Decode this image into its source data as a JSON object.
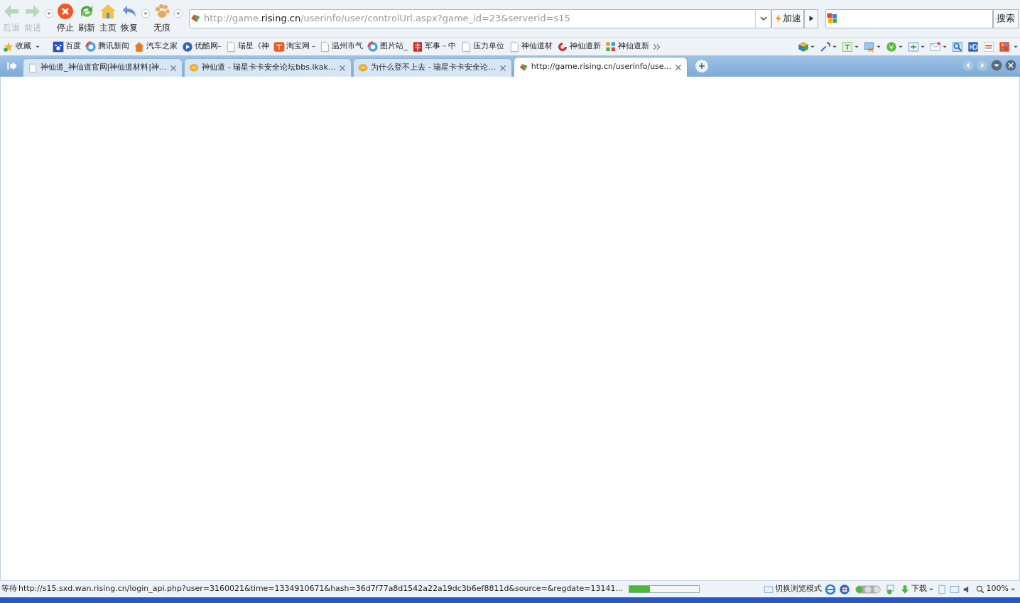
{
  "toolbar": {
    "buttons": [
      {
        "kind": "back",
        "label": "后退",
        "disabled": true
      },
      {
        "kind": "forward",
        "label": "前进",
        "disabled": true
      },
      {
        "kind": "stop",
        "label": "停止",
        "disabled": false
      },
      {
        "kind": "refresh",
        "label": "刷新",
        "disabled": false
      },
      {
        "kind": "home",
        "label": "主页",
        "disabled": false
      },
      {
        "kind": "restore",
        "label": "恢复",
        "disabled": false
      },
      {
        "kind": "private",
        "label": "无痕",
        "disabled": false
      }
    ]
  },
  "address_bar": {
    "host": "http://game.",
    "domain": "rising.cn",
    "path": "/userinfo/user/controlUrl.aspx?game_id=23&serverid=s15",
    "accelerate": "加速"
  },
  "search": {
    "button": "搜索"
  },
  "bookmarks": [
    {
      "kind": "favorites",
      "label": "收藏"
    },
    {
      "kind": "paw",
      "label": "百度"
    },
    {
      "kind": "globe",
      "label": "腾讯新闻"
    },
    {
      "kind": "home",
      "label": "汽车之家"
    },
    {
      "kind": "play",
      "label": "优酷网-"
    },
    {
      "kind": "page",
      "label": "瑞星《神"
    },
    {
      "kind": "shop",
      "label": "淘宝网 -"
    },
    {
      "kind": "page",
      "label": "温州市气"
    },
    {
      "kind": "globe",
      "label": "图片站_"
    },
    {
      "kind": "flag",
      "label": "军事－中"
    },
    {
      "kind": "page",
      "label": "压力单位"
    },
    {
      "kind": "page",
      "label": "神仙道材"
    },
    {
      "kind": "swirl",
      "label": "神仙道新"
    },
    {
      "kind": "grid",
      "label": "神仙道新"
    }
  ],
  "tabs": [
    {
      "kind": "page",
      "title": "神仙道_神仙道官网|神仙道材料|神...",
      "selected": false
    },
    {
      "kind": "chat",
      "title": "神仙道 - 瑞星卡卡安全论坛bbs.ikak...",
      "selected": false
    },
    {
      "kind": "chat",
      "title": "为什么登不上去 - 瑞星卡卡安全论...",
      "selected": false
    },
    {
      "kind": "site",
      "title": "http://game.rising.cn/userinfo/use...",
      "selected": true
    }
  ],
  "status_bar": {
    "state": "等待",
    "url": "http://s15.sxd.wan.rising.cn/login_api.php?user=3160021&time=1334910671&hash=36d7f77a8d1542a22a19dc3b6ef8811d&source=&regdate=13141...",
    "level": 0.3,
    "mode": "切换浏览模式",
    "download": "下载",
    "zoom": "100%"
  }
}
